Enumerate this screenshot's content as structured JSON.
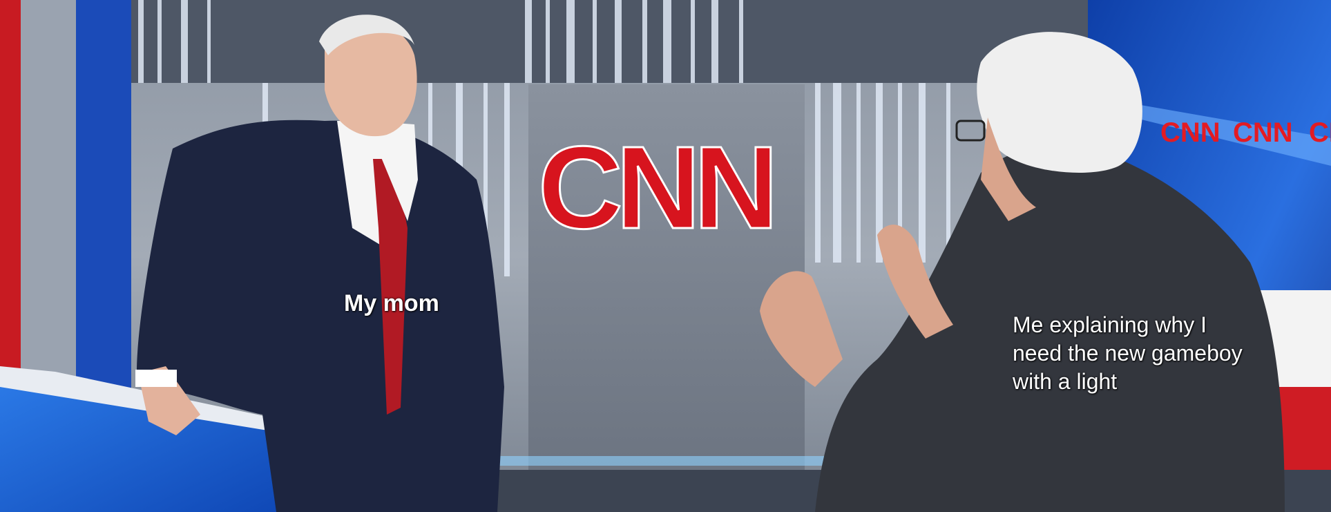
{
  "meme": {
    "caption_left": "My mom",
    "caption_right": "Me explaining why I need the new gameboy with a light"
  },
  "backdrop": {
    "logo_text": "CNN",
    "small_logo_text": "CNN"
  },
  "colors": {
    "logo_red": "#d7141e",
    "suit_navy": "#1d2540",
    "jacket_charcoal": "#33363d",
    "tie_red": "#b11a24",
    "screen_blue": "#1f5cc8"
  }
}
